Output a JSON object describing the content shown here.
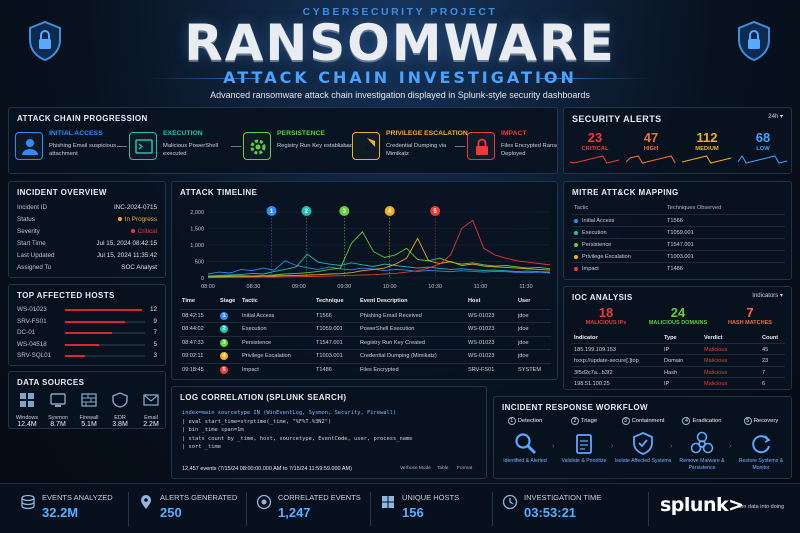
{
  "header": {
    "kicker": "CYBERSECURITY PROJECT",
    "title": "RANSOMWARE",
    "subtitle": "ATTACK CHAIN INVESTIGATION",
    "description": "Advanced ransomware attack chain investigation displayed in Splunk-style security dashboards"
  },
  "attack_chain": {
    "title": "ATTACK CHAIN PROGRESSION",
    "stages": [
      {
        "name": "INITIAL ACCESS",
        "desc": "Phishing Email suspicious attachment",
        "color": "#2f8cff",
        "icon": "user-phish-icon"
      },
      {
        "name": "EXECUTION",
        "desc": "Malicious PowerShell executed",
        "color": "#20c2b4",
        "icon": "terminal-icon"
      },
      {
        "name": "PERSISTENCE",
        "desc": "Registry Run Key established",
        "color": "#5fd13b",
        "icon": "gear-icon"
      },
      {
        "name": "PRIVILEGE ESCALATION",
        "desc": "Credential Dumping via Mimikatz",
        "color": "#f2b01e",
        "icon": "shield-lock-icon"
      },
      {
        "name": "IMPACT",
        "desc": "Files Encrypted Ransom Note Deployed",
        "color": "#f0383b",
        "icon": "padlock-icon"
      }
    ]
  },
  "security_alerts": {
    "title": "SECURITY ALERTS",
    "range": "24h",
    "items": [
      {
        "count": "23",
        "label": "CRITICAL",
        "color": "#f0383b"
      },
      {
        "count": "47",
        "label": "HIGH",
        "color": "#ff6b35"
      },
      {
        "count": "112",
        "label": "MEDIUM",
        "color": "#f2b01e"
      },
      {
        "count": "68",
        "label": "LOW",
        "color": "#4aa3ff"
      }
    ]
  },
  "incident": {
    "title": "INCIDENT OVERVIEW",
    "rows": [
      {
        "k": "Incident ID",
        "v": "INC-2024-0715"
      },
      {
        "k": "Status",
        "v": "In Progress",
        "dot": "#f2b01e"
      },
      {
        "k": "Severity",
        "v": "Critical",
        "dot": "#f0383b"
      },
      {
        "k": "Start Time",
        "v": "Jul 15, 2024 08:42:15"
      },
      {
        "k": "Last Updated",
        "v": "Jul 15, 2024 11:35:42"
      },
      {
        "k": "Assigned To",
        "v": "SOC Analyst"
      }
    ]
  },
  "hosts": {
    "title": "TOP AFFECTED HOSTS",
    "rows": [
      {
        "name": "WS-01023",
        "count": "12",
        "frac": 1
      },
      {
        "name": "SRV-FS01",
        "count": "9",
        "frac": 0.75
      },
      {
        "name": "DC-01",
        "count": "7",
        "frac": 0.58
      },
      {
        "name": "WS-04518",
        "count": "5",
        "frac": 0.42
      },
      {
        "name": "SRV-SQL01",
        "count": "3",
        "frac": 0.25
      }
    ]
  },
  "data_sources": {
    "title": "DATA SOURCES",
    "items": [
      {
        "label": "Windows",
        "value": "12.4M",
        "icon": "windows-icon"
      },
      {
        "label": "Sysmon",
        "value": "8.7M",
        "icon": "sysmon-icon"
      },
      {
        "label": "Firewall",
        "value": "5.1M",
        "icon": "firewall-icon"
      },
      {
        "label": "EDR",
        "value": "3.8M",
        "icon": "edr-icon"
      },
      {
        "label": "Email",
        "value": "2.2M",
        "icon": "email-icon"
      }
    ]
  },
  "timeline": {
    "title": "ATTACK TIMELINE",
    "columns": [
      "Time",
      "Stage",
      "Tactic",
      "Technique",
      "Event Description",
      "Host",
      "User"
    ],
    "rows": [
      [
        "08:42:15",
        "1",
        "Initial Access",
        "T1566",
        "Phishing Email Received",
        "WS-01023",
        "jdoe"
      ],
      [
        "08:44:02",
        "2",
        "Execution",
        "T1059.001",
        "PowerShell Execution",
        "WS-01023",
        "jdoe"
      ],
      [
        "08:47:33",
        "3",
        "Persistence",
        "T1547.001",
        "Registry Run Key Created",
        "WS-01023",
        "jdoe"
      ],
      [
        "09:02:11",
        "4",
        "Privilege Escalation",
        "T1003.001",
        "Credential Dumping (Mimikatz)",
        "WS-01023",
        "jdoe"
      ],
      [
        "09:18:45",
        "5",
        "Impact",
        "T1486",
        "Files Encrypted",
        "SRV-FS01",
        "SYSTEM"
      ]
    ]
  },
  "chart_data": {
    "type": "line",
    "yticks": [
      "2,000",
      "1,500",
      "1,000",
      "500",
      "0"
    ],
    "ylim": [
      0,
      2000
    ],
    "xticks": [
      "08:00",
      "08:30",
      "09:00",
      "09:30",
      "10:00",
      "10:30",
      "11:00",
      "11:30"
    ],
    "markers": [
      "1",
      "2",
      "3",
      "4",
      "5"
    ],
    "markers_x": [
      "08:42",
      "09:05",
      "09:30",
      "10:00",
      "10:30"
    ],
    "series": [
      {
        "color": "#2f8cff",
        "values": [
          120,
          180,
          150,
          260,
          220,
          300,
          240,
          520,
          380,
          310,
          260,
          330,
          280,
          250,
          300,
          270,
          220,
          260,
          240,
          200,
          230,
          210,
          190,
          220,
          200,
          180,
          200,
          190,
          170,
          160,
          180,
          150
        ]
      },
      {
        "color": "#20c2b4",
        "values": [
          60,
          80,
          90,
          110,
          140,
          120,
          200,
          260,
          340,
          720,
          480,
          420,
          380,
          460,
          400,
          350,
          420,
          380,
          340,
          300,
          330,
          290,
          260,
          280,
          250,
          230,
          240,
          220,
          200,
          210,
          190,
          180
        ]
      },
      {
        "color": "#5fd13b",
        "values": [
          40,
          50,
          60,
          70,
          60,
          80,
          90,
          120,
          140,
          160,
          200,
          260,
          300,
          1050,
          1400,
          800,
          620,
          700,
          900,
          560,
          520,
          600,
          480,
          420,
          460,
          400,
          360,
          380,
          340,
          300,
          320,
          280
        ]
      },
      {
        "color": "#f2b01e",
        "values": [
          20,
          30,
          30,
          40,
          50,
          40,
          60,
          70,
          80,
          90,
          100,
          120,
          130,
          160,
          220,
          260,
          300,
          420,
          600,
          1200,
          520,
          440,
          500,
          380,
          420,
          360,
          340,
          320,
          300,
          280,
          260,
          240
        ]
      },
      {
        "color": "#f0383b",
        "values": [
          10,
          15,
          20,
          20,
          25,
          30,
          30,
          35,
          40,
          45,
          50,
          60,
          70,
          80,
          90,
          100,
          120,
          140,
          180,
          220,
          300,
          420,
          700,
          1500,
          1750,
          900,
          700,
          600,
          520,
          480,
          440,
          400
        ]
      }
    ]
  },
  "mitre": {
    "title": "MITRE ATT&CK MAPPING",
    "columns": [
      "Tactic",
      "Techniques Observed"
    ],
    "rows": [
      {
        "t": "Initial Access",
        "v": "T1566",
        "color": "#2f8cff"
      },
      {
        "t": "Execution",
        "v": "T1059.001",
        "color": "#20c2b4"
      },
      {
        "t": "Persistence",
        "v": "T1547.001",
        "color": "#5fd13b"
      },
      {
        "t": "Privilege Escalation",
        "v": "T1003.001",
        "color": "#f2b01e"
      },
      {
        "t": "Impact",
        "v": "T1486",
        "color": "#f0383b"
      }
    ]
  },
  "ioc": {
    "title": "IOC ANALYSIS",
    "filter": "Indicators",
    "summary": [
      {
        "n": "18",
        "l": "MALICIOUS IPs",
        "color": "#f0383b"
      },
      {
        "n": "24",
        "l": "MALICIOUS DOMAINS",
        "color": "#5fd13b"
      },
      {
        "n": "7",
        "l": "HASH MATCHES",
        "color": "#ff6b35"
      }
    ],
    "columns": [
      "Indicator",
      "Type",
      "Verdict",
      "Count"
    ],
    "rows": [
      [
        "185.199.109.153",
        "IP",
        "Malicious",
        "45"
      ],
      [
        "hxxp://update-secure[.]top",
        "Domain",
        "Malicious",
        "23"
      ],
      [
        "3f5d2c7a...b3f2",
        "Hash",
        "Malicious",
        "7"
      ],
      [
        "198.51.100.25",
        "IP",
        "Malicious",
        "6"
      ]
    ]
  },
  "log": {
    "title": "LOG CORRELATION (SPLUNK SEARCH)",
    "query": [
      "index=main sourcetype IN (WinEventLog, Sysmon, Security, Firewall)",
      "| eval start_time=strptime(_time, \"%F%T.%3N2\")",
      "| bin _time span=1m",
      "| stats count by _time, host, sourcetype, EventCode, user, process_name",
      "| sort _time"
    ],
    "events": "12,457 events (7/15/24 08:00:00.000 AM to 7/15/24 11:59:59.000 AM)",
    "views": [
      "Verbose Mode",
      "Table",
      "Format"
    ]
  },
  "workflow": {
    "title": "INCIDENT RESPONSE WORKFLOW",
    "steps": [
      {
        "n": "1",
        "h": "Detection",
        "t": "Identified & Alerted",
        "icon": "magnifier-icon"
      },
      {
        "n": "2",
        "h": "Triage",
        "t": "Validate & Prioritize",
        "icon": "clipboard-icon"
      },
      {
        "n": "3",
        "h": "Containment",
        "t": "Isolate Affected Systems",
        "icon": "shield-icon"
      },
      {
        "n": "4",
        "h": "Eradication",
        "t": "Remove Malware & Persistence",
        "icon": "biohazard-icon"
      },
      {
        "n": "5",
        "h": "Recovery",
        "t": "Restore Systems & Monitor",
        "icon": "refresh-icon"
      }
    ]
  },
  "stats": [
    {
      "label": "EVENTS ANALYZED",
      "value": "32.2M",
      "icon": "database-icon"
    },
    {
      "label": "ALERTS GENERATED",
      "value": "250",
      "icon": "pin-icon"
    },
    {
      "label": "CORRELATED EVENTS",
      "value": "1,247",
      "icon": "link-icon"
    },
    {
      "label": "UNIQUE HOSTS",
      "value": "156",
      "icon": "windows-icon"
    },
    {
      "label": "INVESTIGATION TIME",
      "value": "03:53:21",
      "icon": "clock-icon"
    }
  ],
  "brand": {
    "name": "splunk>",
    "tagline": "turn data into doing"
  }
}
